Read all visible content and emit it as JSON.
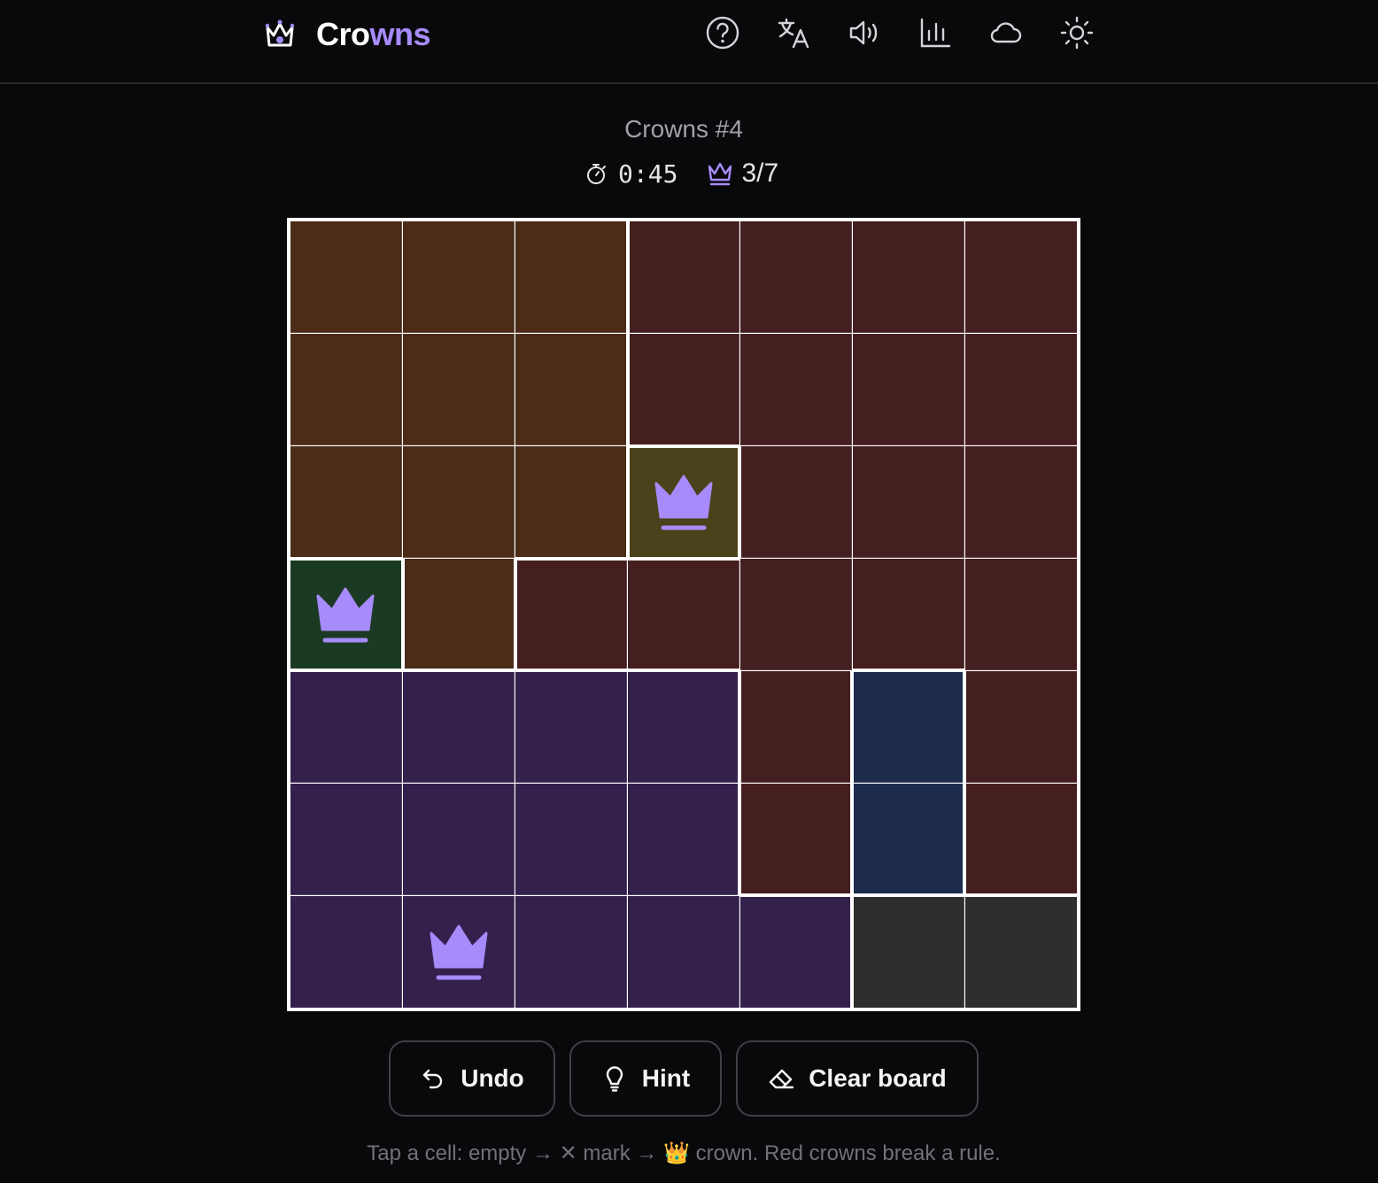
{
  "header": {
    "brand_part1": "Cro",
    "brand_part2": "wns",
    "icons": [
      "help-icon",
      "translate-icon",
      "sound-icon",
      "stats-icon",
      "cloud-icon",
      "theme-sun-icon"
    ]
  },
  "puzzle": {
    "title": "Crowns #4",
    "timer": "0:45",
    "crowns_progress": "3/7"
  },
  "board": {
    "size": 7,
    "regions": [
      [
        0,
        0,
        0,
        1,
        1,
        1,
        1
      ],
      [
        0,
        0,
        0,
        1,
        1,
        1,
        1
      ],
      [
        0,
        0,
        0,
        2,
        1,
        1,
        1
      ],
      [
        3,
        0,
        1,
        1,
        1,
        1,
        1
      ],
      [
        4,
        4,
        4,
        4,
        1,
        5,
        1
      ],
      [
        4,
        4,
        4,
        4,
        1,
        5,
        1
      ],
      [
        4,
        4,
        4,
        4,
        4,
        6,
        6
      ]
    ],
    "region_colors": [
      "#4a2c17",
      "#451e20",
      "#4a421a",
      "#1b3a24",
      "#33204d",
      "#1d2c4d",
      "#2e2e2e"
    ],
    "crowns": [
      [
        2,
        3
      ],
      [
        3,
        0
      ],
      [
        6,
        1
      ]
    ],
    "crown_color": "#a78bfa"
  },
  "actions": {
    "undo_label": "Undo",
    "hint_label": "Hint",
    "clear_label": "Clear board"
  },
  "footer": {
    "instructions": "Tap a cell: empty → ✕ mark → 👑 crown. Red crowns break a rule."
  }
}
